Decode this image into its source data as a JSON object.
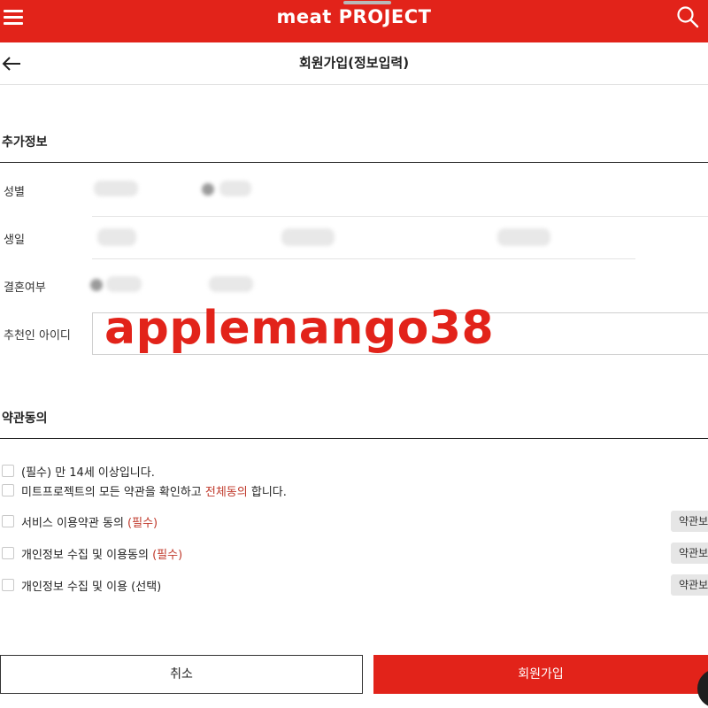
{
  "header": {
    "logo_text": "meat PROJECT",
    "menu_icon": "hamburger-menu-icon",
    "search_icon": "search-icon",
    "brand_color": "#e2231a"
  },
  "titlebar": {
    "title": "회원가입(정보입력)",
    "back_icon": "back-arrow-icon"
  },
  "extra_info": {
    "section_title": "추가정보",
    "gender_label": "성별",
    "birthday_label": "생일",
    "marital_label": "결혼여부",
    "referrer_label": "추천인 아이디",
    "referrer_overlay": "applemango38"
  },
  "agreement": {
    "section_title": "약관동의",
    "items": [
      {
        "prefix": "(필수) 만 14세 이상입니다.",
        "highlight": "",
        "suffix": ""
      },
      {
        "prefix": "미트프로젝트의 모든 약관을 확인하고 ",
        "highlight": "전체동의",
        "suffix": " 합니다."
      },
      {
        "prefix": "서비스 이용약관 동의 ",
        "highlight": "(필수)",
        "suffix": "",
        "button": "약관보기"
      },
      {
        "prefix": "개인정보 수집 및 이용동의 ",
        "highlight": "(필수)",
        "suffix": "",
        "button": "약관보기"
      },
      {
        "prefix": "개인정보 수집 및 이용 (선택)",
        "highlight": "",
        "suffix": "",
        "button": "약관보기"
      }
    ]
  },
  "footer": {
    "cancel_label": "취소",
    "join_label": "회원가입"
  }
}
